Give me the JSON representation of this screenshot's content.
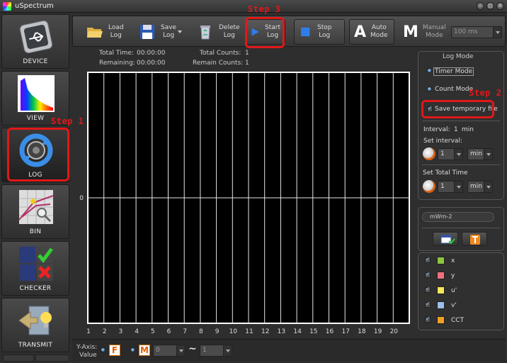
{
  "window": {
    "title": "uSpectrum"
  },
  "sidebar": {
    "items": [
      {
        "label": "DEVICE"
      },
      {
        "label": "VIEW"
      },
      {
        "label": "LOG"
      },
      {
        "label": "BIN"
      },
      {
        "label": "CHECKER"
      },
      {
        "label": "TRANSMIT"
      }
    ]
  },
  "toolbar": {
    "load": {
      "line1": "Load",
      "line2": "Log"
    },
    "save": {
      "line1": "Save",
      "line2": "Log"
    },
    "delete": {
      "line1": "Delete",
      "line2": "Log"
    },
    "start": {
      "line1": "Start",
      "line2": "Log"
    },
    "stop": {
      "line1": "Stop",
      "line2": "Log"
    },
    "auto": {
      "glyph": "A",
      "line1": "Auto",
      "line2": "Mode"
    },
    "manual": {
      "glyph": "M",
      "line1": "Manual",
      "line2": "Mode"
    },
    "exposure_value": "100 ms"
  },
  "info": {
    "total_time_label": "Total Time:",
    "total_time_value": "00:00:00",
    "remaining_label": "Remaining:",
    "remaining_value": "00:00:00",
    "total_counts_label": "Total Counts:",
    "total_counts_value": "1",
    "remain_counts_label": "Remain Counts:",
    "remain_counts_value": "1"
  },
  "chart_data": {
    "type": "line",
    "x_ticks": [
      "1",
      "2",
      "3",
      "4",
      "5",
      "6",
      "7",
      "8",
      "9",
      "10",
      "11",
      "12",
      "13",
      "14",
      "15",
      "16",
      "17",
      "18",
      "19",
      "20"
    ],
    "y_ticks": [
      "0"
    ],
    "series": [],
    "grid": true
  },
  "log_mode": {
    "title": "Log Mode",
    "timer_mode": "Timer Mode",
    "count_mode": "Count Mode",
    "save_temp": "Save temporary file",
    "interval_label": "Interval:",
    "interval_value": "1",
    "interval_unit": "min",
    "set_interval_label": "Set interval:",
    "set_interval_value": "1",
    "set_interval_unit": "min",
    "set_total_label": "Set Total Time",
    "set_total_value": "1",
    "set_total_unit": "min"
  },
  "unit_field": {
    "value": "mWm-2"
  },
  "params": [
    {
      "label": "x",
      "color": "#8ec63f"
    },
    {
      "label": "y",
      "color": "#f07080"
    },
    {
      "label": "u'",
      "color": "#f5e65a"
    },
    {
      "label": "v'",
      "color": "#9cc0e8"
    },
    {
      "label": "CCT",
      "color": "#f3a021"
    }
  ],
  "bottom": {
    "yaxis_line1": "Y-Axis:",
    "yaxis_line2": "Value",
    "f_glyph": "F",
    "m_glyph": "M",
    "combo1_value": "0",
    "combo2_value": "1",
    "tilde": "~"
  },
  "annotations": {
    "step1": "Step 1",
    "step2": "Step 2",
    "step3": "Step 3"
  }
}
